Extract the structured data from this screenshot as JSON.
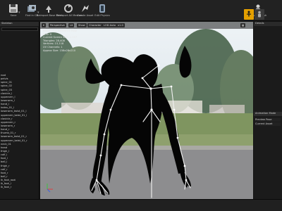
{
  "toolbar": {
    "buttons": [
      {
        "label": "Save"
      },
      {
        "label": "Find in CB"
      },
      {
        "label": "Reimport Base Mesh"
      },
      {
        "label": "Reimport All Meshes"
      },
      {
        "label": "Create Asset"
      },
      {
        "label": "Edit Physics"
      },
      {
        "label": "Preview Mesh"
      }
    ],
    "modes": [
      "Skeleton",
      "Mesh"
    ]
  },
  "left_panel": {
    "tab_title": "Skeleton",
    "tree_items": [
      "root",
      "pelvis",
      "spine_01",
      "spine_02",
      "spine_03",
      "clavicle_l",
      "upperarm_l",
      "lowerarm_l",
      "hand_l",
      "index_01_l",
      "lowerarm_twist_01_l",
      "upperarm_twist_01_l",
      "clavicle_r",
      "upperarm_r",
      "lowerarm_r",
      "hand_r",
      "thumb_01_r",
      "lowerarm_twist_01_r",
      "upperarm_twist_01_r",
      "neck_01",
      "head",
      "thigh_l",
      "calf_l",
      "foot_l",
      "ball_l",
      "thigh_r",
      "calf_r",
      "foot_r",
      "ball_r",
      "ik_foot_root",
      "ik_foot_l",
      "ik_foot_r"
    ]
  },
  "viewport": {
    "controls": [
      "Perspective",
      "Lit",
      "Show",
      "Character",
      "LOD Auto",
      "x1.0"
    ],
    "info_lines": [
      "Previewing Reference Pose",
      "LOD: 0",
      "Current Screen Size: 1.107",
      "Triangles: 28,408",
      "Vertices: 15,118",
      "UV Channels: 1",
      "Approx Size: 158x28x210"
    ]
  },
  "right_panel": {
    "tab_title": "Details",
    "section_title": "Animation Mode",
    "rows": [
      "Preview Pose",
      "Current Asset"
    ]
  },
  "colors": {
    "accent": "#e5a000",
    "silhouette": "#050505",
    "bone_white": "#f0f0f0"
  }
}
